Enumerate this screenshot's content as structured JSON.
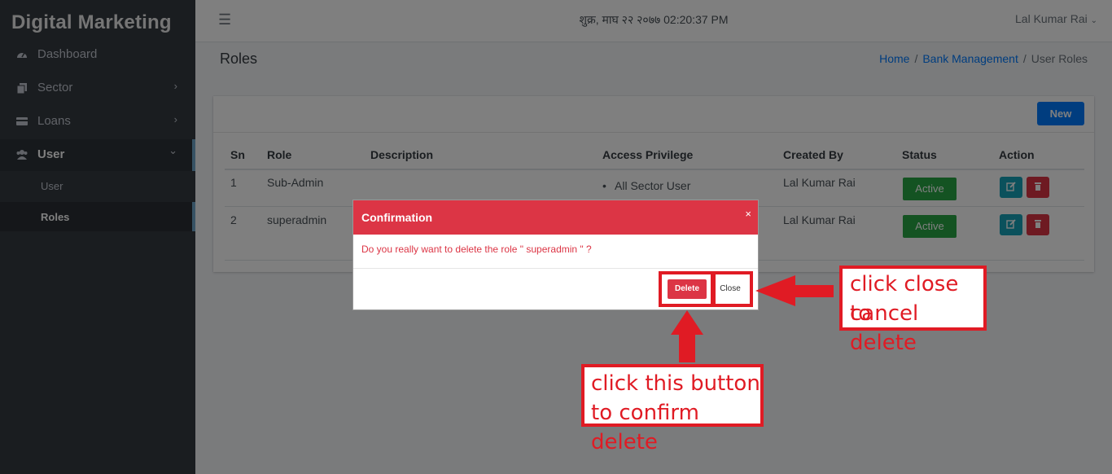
{
  "app": {
    "brand": "Digital Marketing",
    "datetime": "शुक्र, माघ २२ २०७७ 02:20:37 PM",
    "user_menu": "Lal Kumar Rai",
    "user_menu_caret": "⌄",
    "menu_icon": "hamburger-icon"
  },
  "sidebar": {
    "items": [
      {
        "label": "Dashboard",
        "icon": "tachometer-icon"
      },
      {
        "label": "Sector",
        "icon": "copy-icon",
        "chevron": "›"
      },
      {
        "label": "Loans",
        "icon": "card-icon",
        "chevron": "›"
      },
      {
        "label": "User",
        "icon": "users-icon",
        "chevron": "⌄"
      }
    ],
    "subitems": [
      {
        "label": "User"
      },
      {
        "label": "Roles"
      }
    ]
  },
  "header": {
    "title": "Roles",
    "breadcrumb": [
      "Home",
      "Bank Management",
      "User Roles"
    ],
    "separator": "/"
  },
  "card": {
    "new_button": "New"
  },
  "table": {
    "columns": [
      "Sn",
      "Role",
      "Description",
      "Access Privilege",
      "Created By",
      "Status",
      "Action"
    ],
    "rows": [
      {
        "sn": "1",
        "role": "Sub-Admin",
        "description": "",
        "access": "All Sector User",
        "created_by": "Lal Kumar Rai",
        "status": "Active"
      },
      {
        "sn": "2",
        "role": "superadmin",
        "description": "",
        "access": "",
        "created_by": "Lal Kumar Rai",
        "status": "Active"
      }
    ]
  },
  "modal": {
    "title": "Confirmation",
    "close_x": "×",
    "message": "Do you really want to delete the role \" superadmin \" ?",
    "delete_label": "Delete",
    "close_label": "Close"
  },
  "annotations": {
    "close_note": [
      "click close to",
      "cancel delete"
    ],
    "delete_note": [
      "click this button",
      "to confirm delete"
    ],
    "color": "#e01b24"
  },
  "colors": {
    "sidebar_bg": "#343a40",
    "primary": "#007bff",
    "danger": "#dc3545",
    "success": "#28a745",
    "info": "#17a2b8"
  }
}
